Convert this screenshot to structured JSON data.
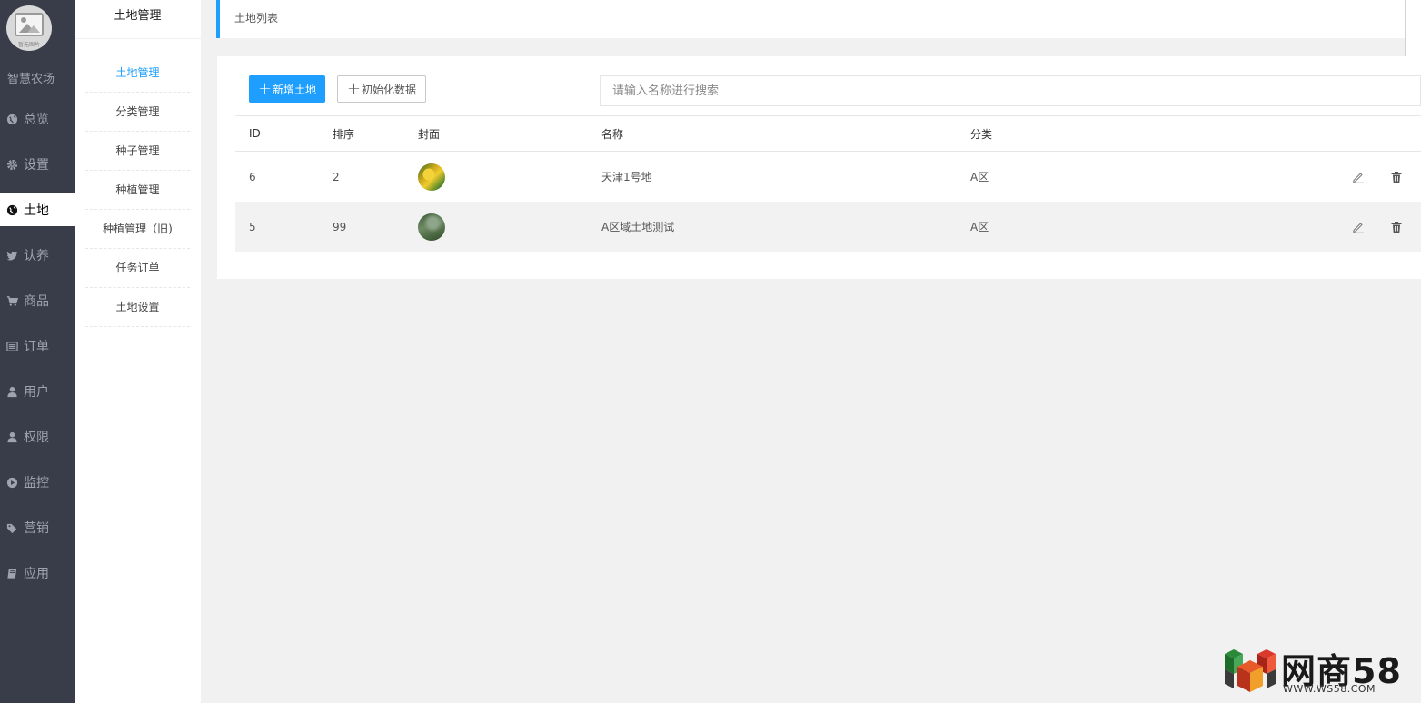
{
  "app": {
    "brand": "智慧农场",
    "avatar_caption": "暂无图片"
  },
  "nav": {
    "items": [
      {
        "label": "总览",
        "icon": "globe-icon"
      },
      {
        "label": "设置",
        "icon": "gear-icon"
      },
      {
        "label": "土地",
        "icon": "globe-icon",
        "active": true
      },
      {
        "label": "认养",
        "icon": "twitter-bird-icon"
      },
      {
        "label": "商品",
        "icon": "cart-icon"
      },
      {
        "label": "订单",
        "icon": "list-icon"
      },
      {
        "label": "用户",
        "icon": "user-icon"
      },
      {
        "label": "权限",
        "icon": "user-icon"
      },
      {
        "label": "监控",
        "icon": "play-circle-icon"
      },
      {
        "label": "营销",
        "icon": "tags-icon"
      },
      {
        "label": "应用",
        "icon": "book-icon"
      }
    ]
  },
  "submenu": {
    "title": "土地管理",
    "items": [
      {
        "label": "土地管理",
        "active": true
      },
      {
        "label": "分类管理"
      },
      {
        "label": "种子管理"
      },
      {
        "label": "种植管理"
      },
      {
        "label": "种植管理（旧)"
      },
      {
        "label": "任务订单"
      },
      {
        "label": "土地设置"
      }
    ]
  },
  "breadcrumb": {
    "title": "土地列表"
  },
  "toolbar": {
    "add_label": "新增土地",
    "init_label": "初始化数据",
    "search_placeholder": "请输入名称进行搜索"
  },
  "table": {
    "columns": [
      "ID",
      "排序",
      "封面",
      "名称",
      "分类"
    ],
    "rows": [
      {
        "id": "6",
        "sort": "2",
        "cover": "corn",
        "name": "天津1号地",
        "category": "A区"
      },
      {
        "id": "5",
        "sort": "99",
        "cover": "field",
        "name": "A区域土地测试",
        "category": "A区"
      }
    ]
  },
  "watermark": {
    "text": "网商58",
    "url": "WWW.WS58.COM"
  },
  "colors": {
    "accent": "#1e9fff",
    "nav_bg": "#393d49",
    "page_bg": "#f1f1f1"
  }
}
